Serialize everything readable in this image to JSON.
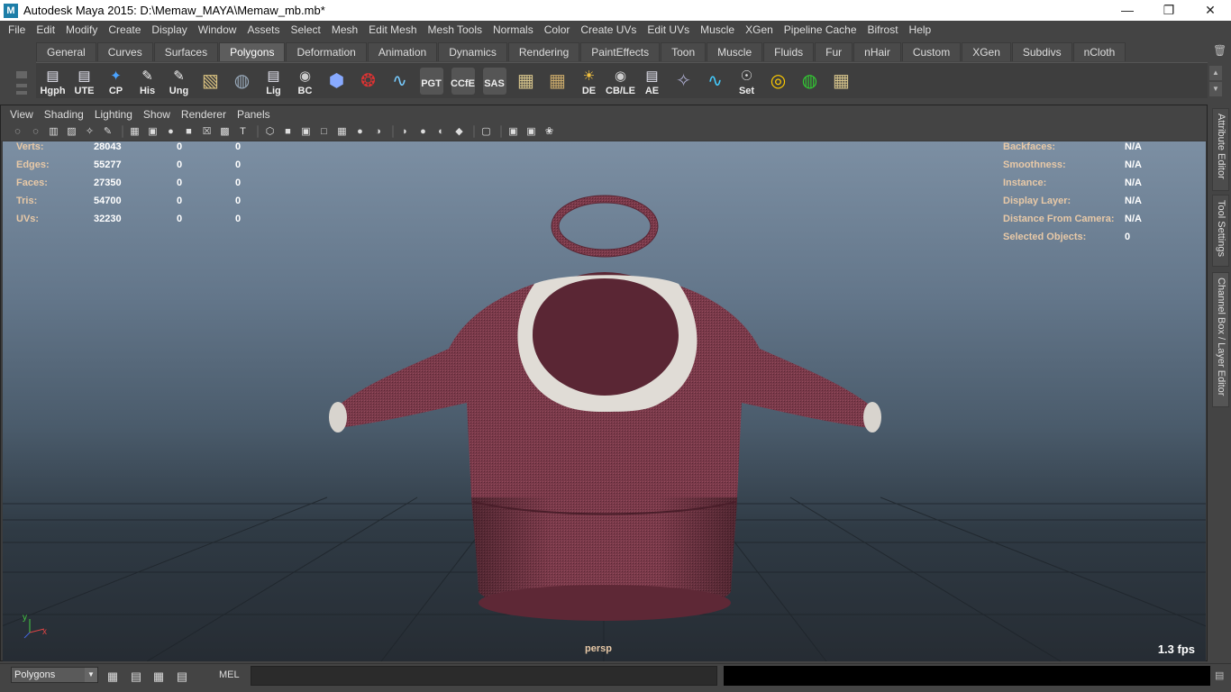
{
  "window": {
    "title": "Autodesk Maya 2015: D:\\Memaw_MAYA\\Memaw_mb.mb*",
    "app_icon_letter": "M",
    "controls": [
      "—",
      "❐",
      "✕"
    ]
  },
  "menubar": [
    "File",
    "Edit",
    "Modify",
    "Create",
    "Display",
    "Window",
    "Assets",
    "Select",
    "Mesh",
    "Edit Mesh",
    "Mesh Tools",
    "Normals",
    "Color",
    "Create UVs",
    "Edit UVs",
    "Muscle",
    "XGen",
    "Pipeline Cache",
    "Bifrost",
    "Help"
  ],
  "shelf": {
    "tabs": [
      "General",
      "Curves",
      "Surfaces",
      "Polygons",
      "Deformation",
      "Animation",
      "Dynamics",
      "Rendering",
      "PaintEffects",
      "Toon",
      "Muscle",
      "Fluids",
      "Fur",
      "nHair",
      "Custom",
      "XGen",
      "Subdivs",
      "nCloth"
    ],
    "active_tab": "Polygons",
    "icons": [
      {
        "label": "Hgph",
        "icon": "window-icon",
        "glyph": "▤",
        "color": "#e8e8f4"
      },
      {
        "label": "UTE",
        "icon": "window-icon",
        "glyph": "▤",
        "color": "#e8e8f4"
      },
      {
        "label": "CP",
        "icon": "axes-icon",
        "glyph": "✦",
        "color": "#4aa3ff"
      },
      {
        "label": "His",
        "icon": "pencil-icon",
        "glyph": "✎",
        "color": "#f0f0f0"
      },
      {
        "label": "Ung",
        "icon": "pencil-icon",
        "glyph": "✎",
        "color": "#f0f0f0"
      },
      {
        "label": "",
        "icon": "box-icon",
        "glyph": "▧",
        "color": "#d8c080"
      },
      {
        "label": "",
        "icon": "globe-icon",
        "glyph": "◍",
        "color": "#9ab"
      },
      {
        "label": "Lig",
        "icon": "window-icon",
        "glyph": "▤",
        "color": "#e8e8f4"
      },
      {
        "label": "BC",
        "icon": "eye-icon",
        "glyph": "◉",
        "color": "#ccc"
      },
      {
        "label": "",
        "icon": "cube-icon",
        "glyph": "⬢",
        "color": "#88aaff"
      },
      {
        "label": "",
        "icon": "camera-icon",
        "glyph": "❂",
        "color": "#d33"
      },
      {
        "label": "",
        "icon": "curve-icon",
        "glyph": "∿",
        "color": "#7cf"
      },
      {
        "label": "PGT",
        "icon": "blank-icon",
        "glyph": "",
        "color": "#555"
      },
      {
        "label": "CCfE",
        "icon": "blank-icon",
        "glyph": "",
        "color": "#555"
      },
      {
        "label": "SAS",
        "icon": "blank-icon",
        "glyph": "",
        "color": "#555"
      },
      {
        "label": "",
        "icon": "uv-grid-icon",
        "glyph": "▦",
        "color": "#d4c28a"
      },
      {
        "label": "",
        "icon": "uv-grid-icon",
        "glyph": "▦",
        "color": "#c8a86a"
      },
      {
        "label": "DE",
        "icon": "light-icon",
        "glyph": "☀",
        "color": "#f0c040"
      },
      {
        "label": "CB/LE",
        "icon": "eye-icon",
        "glyph": "◉",
        "color": "#ccc"
      },
      {
        "label": "AE",
        "icon": "window-icon",
        "glyph": "▤",
        "color": "#e8e8f4"
      },
      {
        "label": "",
        "icon": "lamp-icon",
        "glyph": "✧",
        "color": "#aac"
      },
      {
        "label": "",
        "icon": "curve-icon",
        "glyph": "∿",
        "color": "#4cf"
      },
      {
        "label": "Set",
        "icon": "key-icon",
        "glyph": "☉",
        "color": "#ddd"
      },
      {
        "label": "",
        "icon": "target-icon",
        "glyph": "◎",
        "color": "#ffcc00"
      },
      {
        "label": "",
        "icon": "rotate-icon",
        "glyph": "◍",
        "color": "#3c3"
      },
      {
        "label": "",
        "icon": "uv-grid-icon",
        "glyph": "▦",
        "color": "#d4c28a"
      }
    ]
  },
  "panel": {
    "menus": [
      "View",
      "Shading",
      "Lighting",
      "Show",
      "Renderer",
      "Panels"
    ],
    "tools": [
      {
        "icon": "camera-attrs-icon",
        "glyph": "◌"
      },
      {
        "icon": "camera-tools-icon",
        "glyph": "◌"
      },
      {
        "icon": "bookmarks-icon",
        "glyph": "▥"
      },
      {
        "icon": "image-plane-icon",
        "glyph": "▨"
      },
      {
        "icon": "2d-pan-icon",
        "glyph": "✧"
      },
      {
        "icon": "grease-pencil-icon",
        "glyph": "✎"
      },
      {
        "sep": true
      },
      {
        "icon": "grid-icon",
        "glyph": "▦"
      },
      {
        "icon": "film-gate-icon",
        "glyph": "▣"
      },
      {
        "icon": "resolution-gate-icon",
        "glyph": "●"
      },
      {
        "icon": "gate-mask-icon",
        "glyph": "■"
      },
      {
        "icon": "field-chart-icon",
        "glyph": "☒"
      },
      {
        "icon": "safe-action-icon",
        "glyph": "▩"
      },
      {
        "icon": "safe-title-icon",
        "glyph": "T"
      },
      {
        "sep": true
      },
      {
        "icon": "wireframe-icon",
        "glyph": "⬡"
      },
      {
        "icon": "smooth-shade-icon",
        "glyph": "■"
      },
      {
        "icon": "wireframe-on-shaded-icon",
        "glyph": "▣"
      },
      {
        "icon": "default-material-icon",
        "glyph": "□"
      },
      {
        "icon": "textured-icon",
        "glyph": "▦"
      },
      {
        "icon": "use-lights-icon",
        "glyph": "●"
      },
      {
        "icon": "shadows-icon",
        "glyph": "◑"
      },
      {
        "sep": true
      },
      {
        "icon": "ssao-icon",
        "glyph": "◗"
      },
      {
        "icon": "motion-blur-icon",
        "glyph": "●"
      },
      {
        "icon": "multisample-icon",
        "glyph": "◐"
      },
      {
        "icon": "depth-of-field-icon",
        "glyph": "◆"
      },
      {
        "sep": true
      },
      {
        "icon": "isolate-select-icon",
        "glyph": "▢"
      },
      {
        "sep": true
      },
      {
        "icon": "xray-icon",
        "glyph": "▣"
      },
      {
        "icon": "xray-joints-icon",
        "glyph": "▣"
      },
      {
        "icon": "node-editor-icon",
        "glyph": "❀"
      }
    ]
  },
  "hud": {
    "left": [
      {
        "label": "Verts:",
        "values": [
          "28043",
          "0",
          "0"
        ]
      },
      {
        "label": "Edges:",
        "values": [
          "55277",
          "0",
          "0"
        ]
      },
      {
        "label": "Faces:",
        "values": [
          "27350",
          "0",
          "0"
        ]
      },
      {
        "label": "Tris:",
        "values": [
          "54700",
          "0",
          "0"
        ]
      },
      {
        "label": "UVs:",
        "values": [
          "32230",
          "0",
          "0"
        ]
      }
    ],
    "right": [
      {
        "label": "Backfaces:",
        "value": "N/A"
      },
      {
        "label": "Smoothness:",
        "value": "N/A"
      },
      {
        "label": "Instance:",
        "value": "N/A"
      },
      {
        "label": "Display Layer:",
        "value": "N/A"
      },
      {
        "label": "Distance From Camera:",
        "value": "N/A"
      },
      {
        "label": "Selected Objects:",
        "value": "0"
      }
    ],
    "camera": "persp",
    "fps": "1.3 fps",
    "axis_y": "y",
    "axis_x": "x"
  },
  "side_tabs": [
    "Attribute Editor",
    "Tool Settings",
    "Channel Box / Layer Editor"
  ],
  "command_line": {
    "mode": "Polygons",
    "mel_label": "MEL"
  },
  "colors": {
    "sweater": "#7a3a4a",
    "collar": "#e0dcd6",
    "hud_label": "#e8c9a7"
  }
}
